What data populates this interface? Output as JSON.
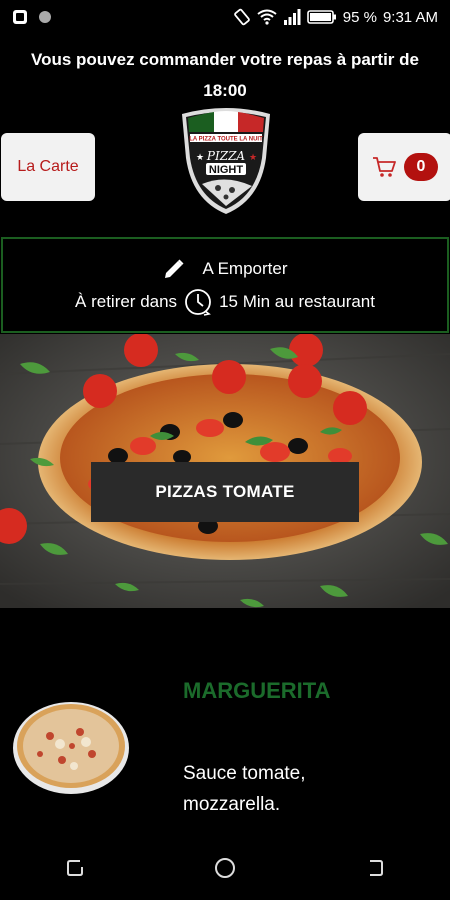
{
  "status_bar": {
    "battery_level": "95 %",
    "time": "9:31 AM",
    "icons": [
      "notification-icon",
      "record-icon",
      "rotation-lock-icon",
      "wifi-icon",
      "signal-icon",
      "battery-icon"
    ]
  },
  "banner": {
    "line1": "Vous pouvez commander votre repas à partir de",
    "line2": "18:00"
  },
  "header": {
    "menu_button_label": "La Carte",
    "cart_count": "0"
  },
  "logo": {
    "brand_name_top": "PIZZA",
    "brand_name_bottom": "NIGHT",
    "tagline": "LA PIZZA TOUTE LA NUIT",
    "colors": [
      "#1b5e20",
      "#ffffff",
      "#c62828"
    ]
  },
  "order_mode": {
    "mode_label": "A Emporter",
    "pickup_prefix": "À retirer dans",
    "pickup_time": "15 Min au restaurant"
  },
  "hero": {
    "category_label": "PIZZAS TOMATE"
  },
  "product": {
    "name": "MARGUERITA",
    "description": "Sauce tomate, mozzarella."
  },
  "nav": {
    "icons": [
      "recents-icon",
      "home-icon",
      "back-icon"
    ]
  },
  "colors": {
    "accent_red": "#b3110f",
    "accent_green": "#1b6b2b",
    "background": "#000000"
  }
}
